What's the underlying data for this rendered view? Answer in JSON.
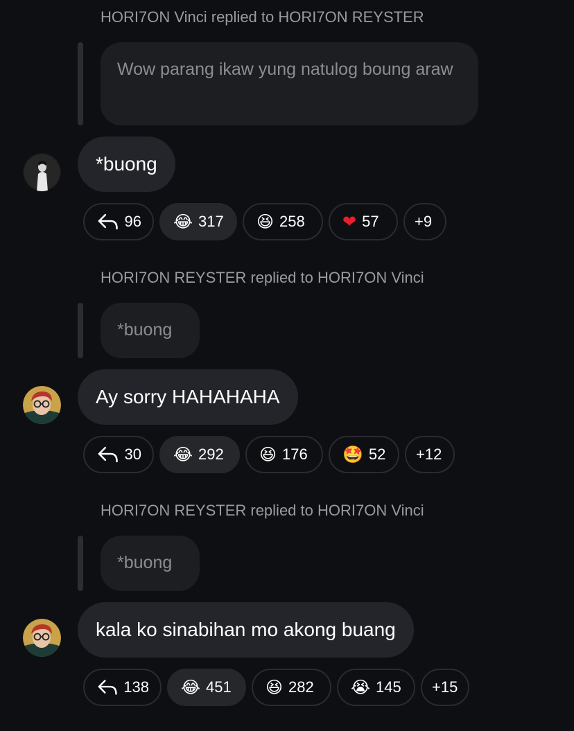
{
  "threads": [
    {
      "header": "HORI7ON Vinci replied to HORI7ON REYSTER",
      "quote": "Wow parang ikaw yung natulog boung araw",
      "message": "*buong",
      "avatar": "dark-portrait-avatar",
      "reactions": [
        {
          "icon": "reply-arrow-icon",
          "count": "96"
        },
        {
          "icon": "laugh-cry-emoji",
          "count": "317",
          "active": true
        },
        {
          "icon": "grin-squint-emoji",
          "count": "258"
        },
        {
          "icon": "red-heart-emoji",
          "count": "57"
        },
        {
          "icon": "",
          "count": "+9"
        }
      ]
    },
    {
      "header": "HORI7ON REYSTER replied to HORI7ON Vinci",
      "quote": "*buong",
      "message": "Ay sorry HAHAHAHA",
      "avatar": "red-hair-glasses-avatar",
      "reactions": [
        {
          "icon": "reply-arrow-icon",
          "count": "30"
        },
        {
          "icon": "laugh-cry-emoji",
          "count": "292",
          "active": true
        },
        {
          "icon": "grin-squint-emoji",
          "count": "176"
        },
        {
          "icon": "star-struck-emoji",
          "count": "52"
        },
        {
          "icon": "",
          "count": "+12"
        }
      ]
    },
    {
      "header": "HORI7ON REYSTER replied to HORI7ON Vinci",
      "quote": "*buong",
      "message": "kala ko sinabihan mo akong buang",
      "avatar": "red-hair-glasses-avatar",
      "reactions": [
        {
          "icon": "reply-arrow-icon",
          "count": "138"
        },
        {
          "icon": "laugh-cry-emoji",
          "count": "451",
          "active": true
        },
        {
          "icon": "grin-squint-emoji",
          "count": "282"
        },
        {
          "icon": "loudly-crying-emoji",
          "count": "145"
        },
        {
          "icon": "",
          "count": "+15"
        }
      ]
    }
  ],
  "colors": {
    "background": "#0e0f13",
    "bubble": "#24252a",
    "quote_bubble": "#1d1e22",
    "muted_text": "#9a9ba0"
  }
}
